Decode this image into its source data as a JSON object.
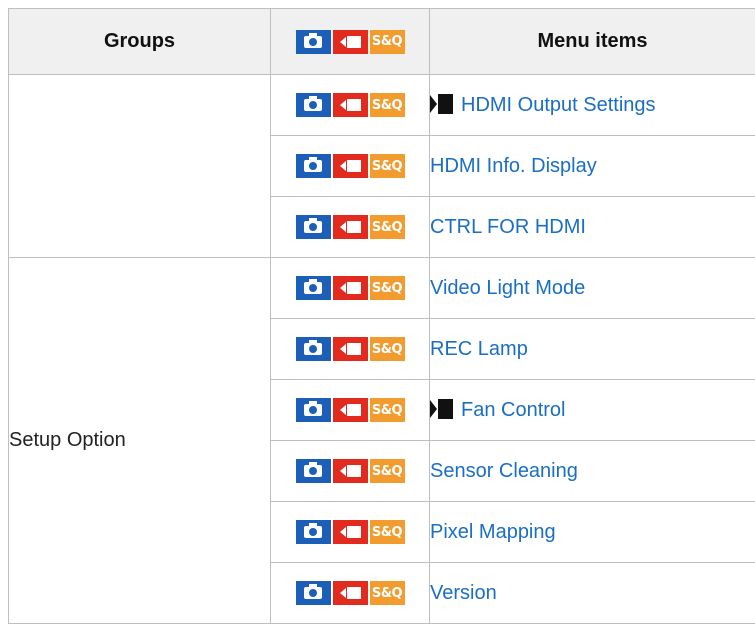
{
  "header": {
    "groups_label": "Groups",
    "menu_items_label": "Menu items",
    "sq_badge": "S&Q"
  },
  "badges": {
    "photo_icon": "camera-icon",
    "movie_icon": "movie-camera-icon",
    "sq_label": "S&Q",
    "colors": {
      "photo": "#1c5fb8",
      "movie": "#e22a1e",
      "sq": "#f29b2e"
    }
  },
  "groups": [
    {
      "label": "",
      "rows": 3
    },
    {
      "label": "Setup Option",
      "rows": 6
    }
  ],
  "rows": [
    {
      "item": "HDMI Output Settings",
      "movie_mark": true,
      "sq_badge": "S&Q"
    },
    {
      "item": "HDMI Info. Display",
      "movie_mark": false,
      "sq_badge": "S&Q"
    },
    {
      "item": "CTRL FOR HDMI",
      "movie_mark": false,
      "sq_badge": "S&Q"
    },
    {
      "item": "Video Light Mode",
      "movie_mark": false,
      "sq_badge": "S&Q"
    },
    {
      "item": "REC Lamp",
      "movie_mark": false,
      "sq_badge": "S&Q"
    },
    {
      "item": "Fan Control",
      "movie_mark": true,
      "sq_badge": "S&Q"
    },
    {
      "item": "Sensor Cleaning",
      "movie_mark": false,
      "sq_badge": "S&Q"
    },
    {
      "item": "Pixel Mapping",
      "movie_mark": false,
      "sq_badge": "S&Q"
    },
    {
      "item": "Version",
      "movie_mark": false,
      "sq_badge": "S&Q"
    }
  ],
  "link_color": "#1a6ec4"
}
